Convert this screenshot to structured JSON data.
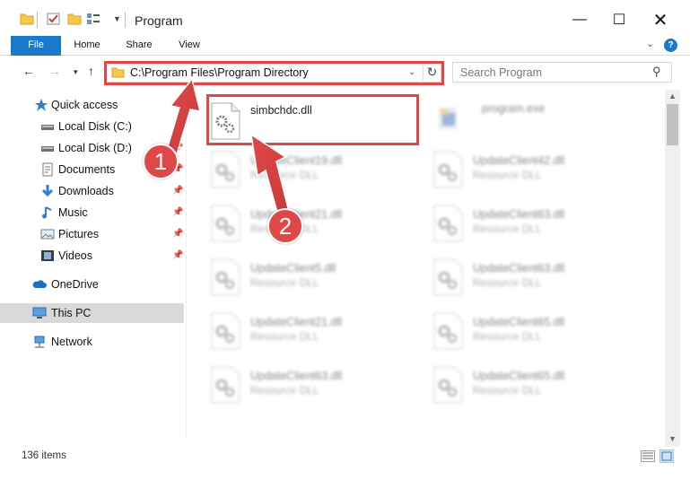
{
  "window": {
    "title": "Program",
    "minimize_glyph": "—",
    "maximize_glyph": "☐",
    "close_glyph": "✕"
  },
  "ribbon": {
    "tabs": [
      {
        "label": "File"
      },
      {
        "label": "Home"
      },
      {
        "label": "Share"
      },
      {
        "label": "View"
      }
    ],
    "help_glyph": "?"
  },
  "address_bar": {
    "path": "C:\\Program Files\\Program Directory",
    "refresh_glyph": "↻"
  },
  "search": {
    "placeholder": "Search Program"
  },
  "sidebar": {
    "items": [
      {
        "label": "Quick access",
        "icon": "star-icon",
        "pinned": false
      },
      {
        "label": "Local Disk (C:)",
        "icon": "drive-icon",
        "pinned": false
      },
      {
        "label": "Local Disk (D:)",
        "icon": "drive-icon",
        "pinned": true
      },
      {
        "label": "Documents",
        "icon": "documents-icon",
        "pinned": true
      },
      {
        "label": "Downloads",
        "icon": "download-icon",
        "pinned": true
      },
      {
        "label": "Music",
        "icon": "music-icon",
        "pinned": true
      },
      {
        "label": "Pictures",
        "icon": "pictures-icon",
        "pinned": true
      },
      {
        "label": "Videos",
        "icon": "videos-icon",
        "pinned": true
      },
      {
        "label": "OneDrive",
        "icon": "cloud-icon",
        "pinned": false
      },
      {
        "label": "This PC",
        "icon": "computer-icon",
        "pinned": false,
        "selected": true
      },
      {
        "label": "Network",
        "icon": "network-icon",
        "pinned": false
      }
    ]
  },
  "files": [
    {
      "name": "simbchdc.dll",
      "type": "",
      "highlighted": true
    },
    {
      "name": "program.exe",
      "type": ""
    },
    {
      "name": "UpdateClient19.dll",
      "type": "Resource DLL"
    },
    {
      "name": "UpdateClient42.dll",
      "type": "Resource DLL"
    },
    {
      "name": "UpdateClient21.dll",
      "type": "Resource DLL"
    },
    {
      "name": "UpdateClient63.dll",
      "type": "Resource DLL"
    },
    {
      "name": "UpdateClient5.dll",
      "type": "Resource DLL"
    },
    {
      "name": "UpdateClient63.dll",
      "type": "Resource DLL"
    },
    {
      "name": "UpdateClient21.dll",
      "type": "Resource DLL"
    },
    {
      "name": "UpdateClient65.dll",
      "type": "Resource DLL"
    },
    {
      "name": "UpdateClient63.dll",
      "type": "Resource DLL"
    },
    {
      "name": "UpdateClient65.dll",
      "type": "Resource DLL"
    }
  ],
  "status": {
    "item_count": "136 items"
  },
  "annotations": {
    "step1": "1",
    "step2": "2",
    "color": "#e04848"
  }
}
